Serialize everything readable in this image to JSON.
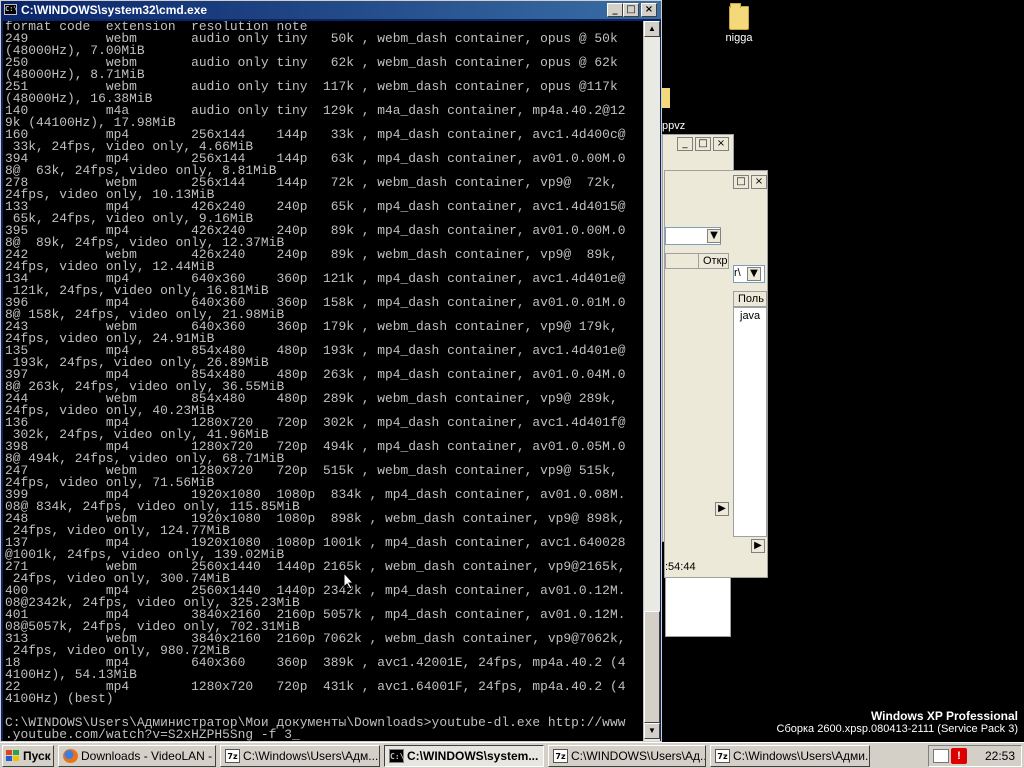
{
  "desktop": {
    "icons": [
      {
        "label": "nigga"
      },
      {
        "label": "ppvz"
      }
    ]
  },
  "bg_windows": {
    "explorer_header_label": "Откр",
    "dialog_header_label": "Поль",
    "dialog_item": "java",
    "combo_value": "r\\",
    "status_time": ":54:44"
  },
  "cmd": {
    "title": "C:\\WINDOWS\\system32\\cmd.exe",
    "icon_text": "C:\\",
    "buttons": {
      "minimize": "_",
      "maximize": "□",
      "close": "×"
    },
    "console_lines": [
      "format code  extension  resolution note",
      "249          webm       audio only tiny   50k , webm_dash container, opus @ 50k",
      "(48000Hz), 7.00MiB",
      "250          webm       audio only tiny   62k , webm_dash container, opus @ 62k",
      "(48000Hz), 8.71MiB",
      "251          webm       audio only tiny  117k , webm_dash container, opus @117k",
      "(48000Hz), 16.38MiB",
      "140          m4a        audio only tiny  129k , m4a_dash container, mp4a.40.2@12",
      "9k (44100Hz), 17.98MiB",
      "160          mp4        256x144    144p   33k , mp4_dash container, avc1.4d400c@",
      " 33k, 24fps, video only, 4.66MiB",
      "394          mp4        256x144    144p   63k , mp4_dash container, av01.0.00M.0",
      "8@  63k, 24fps, video only, 8.81MiB",
      "278          webm       256x144    144p   72k , webm_dash container, vp9@  72k,",
      "24fps, video only, 10.13MiB",
      "133          mp4        426x240    240p   65k , mp4_dash container, avc1.4d4015@",
      " 65k, 24fps, video only, 9.16MiB",
      "395          mp4        426x240    240p   89k , mp4_dash container, av01.0.00M.0",
      "8@  89k, 24fps, video only, 12.37MiB",
      "242          webm       426x240    240p   89k , webm_dash container, vp9@  89k,",
      "24fps, video only, 12.44MiB",
      "134          mp4        640x360    360p  121k , mp4_dash container, avc1.4d401e@",
      " 121k, 24fps, video only, 16.81MiB",
      "396          mp4        640x360    360p  158k , mp4_dash container, av01.0.01M.0",
      "8@ 158k, 24fps, video only, 21.98MiB",
      "243          webm       640x360    360p  179k , webm_dash container, vp9@ 179k,",
      "24fps, video only, 24.91MiB",
      "135          mp4        854x480    480p  193k , mp4_dash container, avc1.4d401e@",
      " 193k, 24fps, video only, 26.89MiB",
      "397          mp4        854x480    480p  263k , mp4_dash container, av01.0.04M.0",
      "8@ 263k, 24fps, video only, 36.55MiB",
      "244          webm       854x480    480p  289k , webm_dash container, vp9@ 289k,",
      "24fps, video only, 40.23MiB",
      "136          mp4        1280x720   720p  302k , mp4_dash container, avc1.4d401f@",
      " 302k, 24fps, video only, 41.96MiB",
      "398          mp4        1280x720   720p  494k , mp4_dash container, av01.0.05M.0",
      "8@ 494k, 24fps, video only, 68.71MiB",
      "247          webm       1280x720   720p  515k , webm_dash container, vp9@ 515k,",
      "24fps, video only, 71.56MiB",
      "399          mp4        1920x1080  1080p  834k , mp4_dash container, av01.0.08M.",
      "08@ 834k, 24fps, video only, 115.85MiB",
      "248          webm       1920x1080  1080p  898k , webm_dash container, vp9@ 898k,",
      " 24fps, video only, 124.77MiB",
      "137          mp4        1920x1080  1080p 1001k , mp4_dash container, avc1.640028",
      "@1001k, 24fps, video only, 139.02MiB",
      "271          webm       2560x1440  1440p 2165k , webm_dash container, vp9@2165k,",
      " 24fps, video only, 300.74MiB",
      "400          mp4        2560x1440  1440p 2342k , mp4_dash container, av01.0.12M.",
      "08@2342k, 24fps, video only, 325.23MiB",
      "401          mp4        3840x2160  2160p 5057k , mp4_dash container, av01.0.12M.",
      "08@5057k, 24fps, video only, 702.31MiB",
      "313          webm       3840x2160  2160p 7062k , webm_dash container, vp9@7062k,",
      " 24fps, video only, 980.72MiB",
      "18           mp4        640x360    360p  389k , avc1.42001E, 24fps, mp4a.40.2 (4",
      "4100Hz), 54.13MiB",
      "22           mp4        1280x720   720p  431k , avc1.64001F, 24fps, mp4a.40.2 (4",
      "4100Hz) (best)",
      "",
      "C:\\WINDOWS\\Users\\Администратор\\Мои документы\\Downloads>youtube-dl.exe http://www",
      ".youtube.com/watch?v=S2xHZPH5Sng -f 3_"
    ]
  },
  "branding": {
    "edition": "Windows XP Professional",
    "build": "Сборка 2600.xpsp.080413-2111 (Service Pack 3)"
  },
  "taskbar": {
    "start_label": "Пуск",
    "buttons": [
      {
        "label": "Downloads - VideoLAN - ..."
      },
      {
        "label": "C:\\Windows\\Users\\Адм..."
      },
      {
        "label": "C:\\WINDOWS\\system..."
      },
      {
        "label": "C:\\WINDOWS\\Users\\Ад..."
      },
      {
        "label": "C:\\Windows\\Users\\Адми..."
      }
    ],
    "clock": "22:53"
  }
}
